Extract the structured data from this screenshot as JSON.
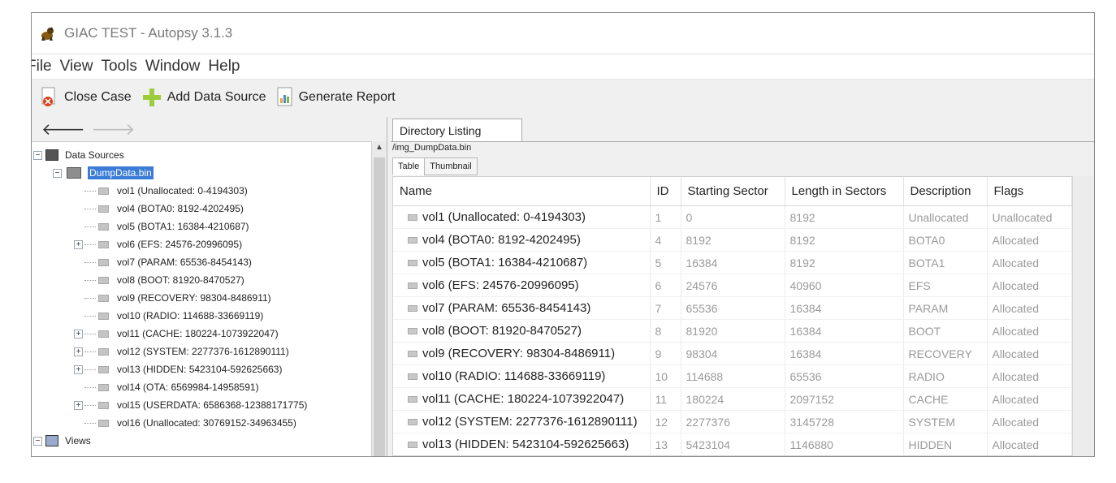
{
  "window": {
    "title": "GIAC TEST - Autopsy 3.1.3"
  },
  "menu": [
    "File",
    "View",
    "Tools",
    "Window",
    "Help"
  ],
  "toolbar": {
    "close_case": "Close Case",
    "add_data_source": "Add Data Source",
    "generate_report": "Generate Report"
  },
  "tree": {
    "root": "Data Sources",
    "image": "DumpData.bin",
    "views": "Views",
    "volumes": [
      {
        "label": "vol1 (Unallocated: 0-4194303)",
        "expandable": false
      },
      {
        "label": "vol4 (BOTA0: 8192-4202495)",
        "expandable": false
      },
      {
        "label": "vol5 (BOTA1: 16384-4210687)",
        "expandable": false
      },
      {
        "label": "vol6 (EFS: 24576-20996095)",
        "expandable": true
      },
      {
        "label": "vol7 (PARAM: 65536-8454143)",
        "expandable": false
      },
      {
        "label": "vol8 (BOOT: 81920-8470527)",
        "expandable": false
      },
      {
        "label": "vol9 (RECOVERY: 98304-8486911)",
        "expandable": false
      },
      {
        "label": "vol10 (RADIO: 114688-33669119)",
        "expandable": false
      },
      {
        "label": "vol11 (CACHE: 180224-1073922047)",
        "expandable": true
      },
      {
        "label": "vol12 (SYSTEM: 2277376-1612890111)",
        "expandable": true
      },
      {
        "label": "vol13 (HIDDEN: 5423104-592625663)",
        "expandable": true
      },
      {
        "label": "vol14 (OTA: 6569984-14958591)",
        "expandable": false
      },
      {
        "label": "vol15 (USERDATA: 6586368-12388171775)",
        "expandable": true
      },
      {
        "label": "vol16 (Unallocated: 30769152-34963455)",
        "expandable": false
      }
    ]
  },
  "content": {
    "tab": "Directory Listing",
    "path": "/img_DumpData.bin",
    "subtabs": [
      "Table",
      "Thumbnail"
    ],
    "columns": [
      "Name",
      "ID",
      "Starting Sector",
      "Length in Sectors",
      "Description",
      "Flags"
    ],
    "rows": [
      [
        "vol1 (Unallocated: 0-4194303)",
        "1",
        "0",
        "8192",
        "Unallocated",
        "Unallocated"
      ],
      [
        "vol4 (BOTA0: 8192-4202495)",
        "4",
        "8192",
        "8192",
        "BOTA0",
        "Allocated"
      ],
      [
        "vol5 (BOTA1: 16384-4210687)",
        "5",
        "16384",
        "8192",
        "BOTA1",
        "Allocated"
      ],
      [
        "vol6 (EFS: 24576-20996095)",
        "6",
        "24576",
        "40960",
        "EFS",
        "Allocated"
      ],
      [
        "vol7 (PARAM: 65536-8454143)",
        "7",
        "65536",
        "16384",
        "PARAM",
        "Allocated"
      ],
      [
        "vol8 (BOOT: 81920-8470527)",
        "8",
        "81920",
        "16384",
        "BOOT",
        "Allocated"
      ],
      [
        "vol9 (RECOVERY: 98304-8486911)",
        "9",
        "98304",
        "16384",
        "RECOVERY",
        "Allocated"
      ],
      [
        "vol10 (RADIO: 114688-33669119)",
        "10",
        "114688",
        "65536",
        "RADIO",
        "Allocated"
      ],
      [
        "vol11 (CACHE: 180224-1073922047)",
        "11",
        "180224",
        "2097152",
        "CACHE",
        "Allocated"
      ],
      [
        "vol12 (SYSTEM: 2277376-1612890111)",
        "12",
        "2277376",
        "3145728",
        "SYSTEM",
        "Allocated"
      ],
      [
        "vol13 (HIDDEN: 5423104-592625663)",
        "13",
        "5423104",
        "1146880",
        "HIDDEN",
        "Allocated"
      ]
    ]
  }
}
